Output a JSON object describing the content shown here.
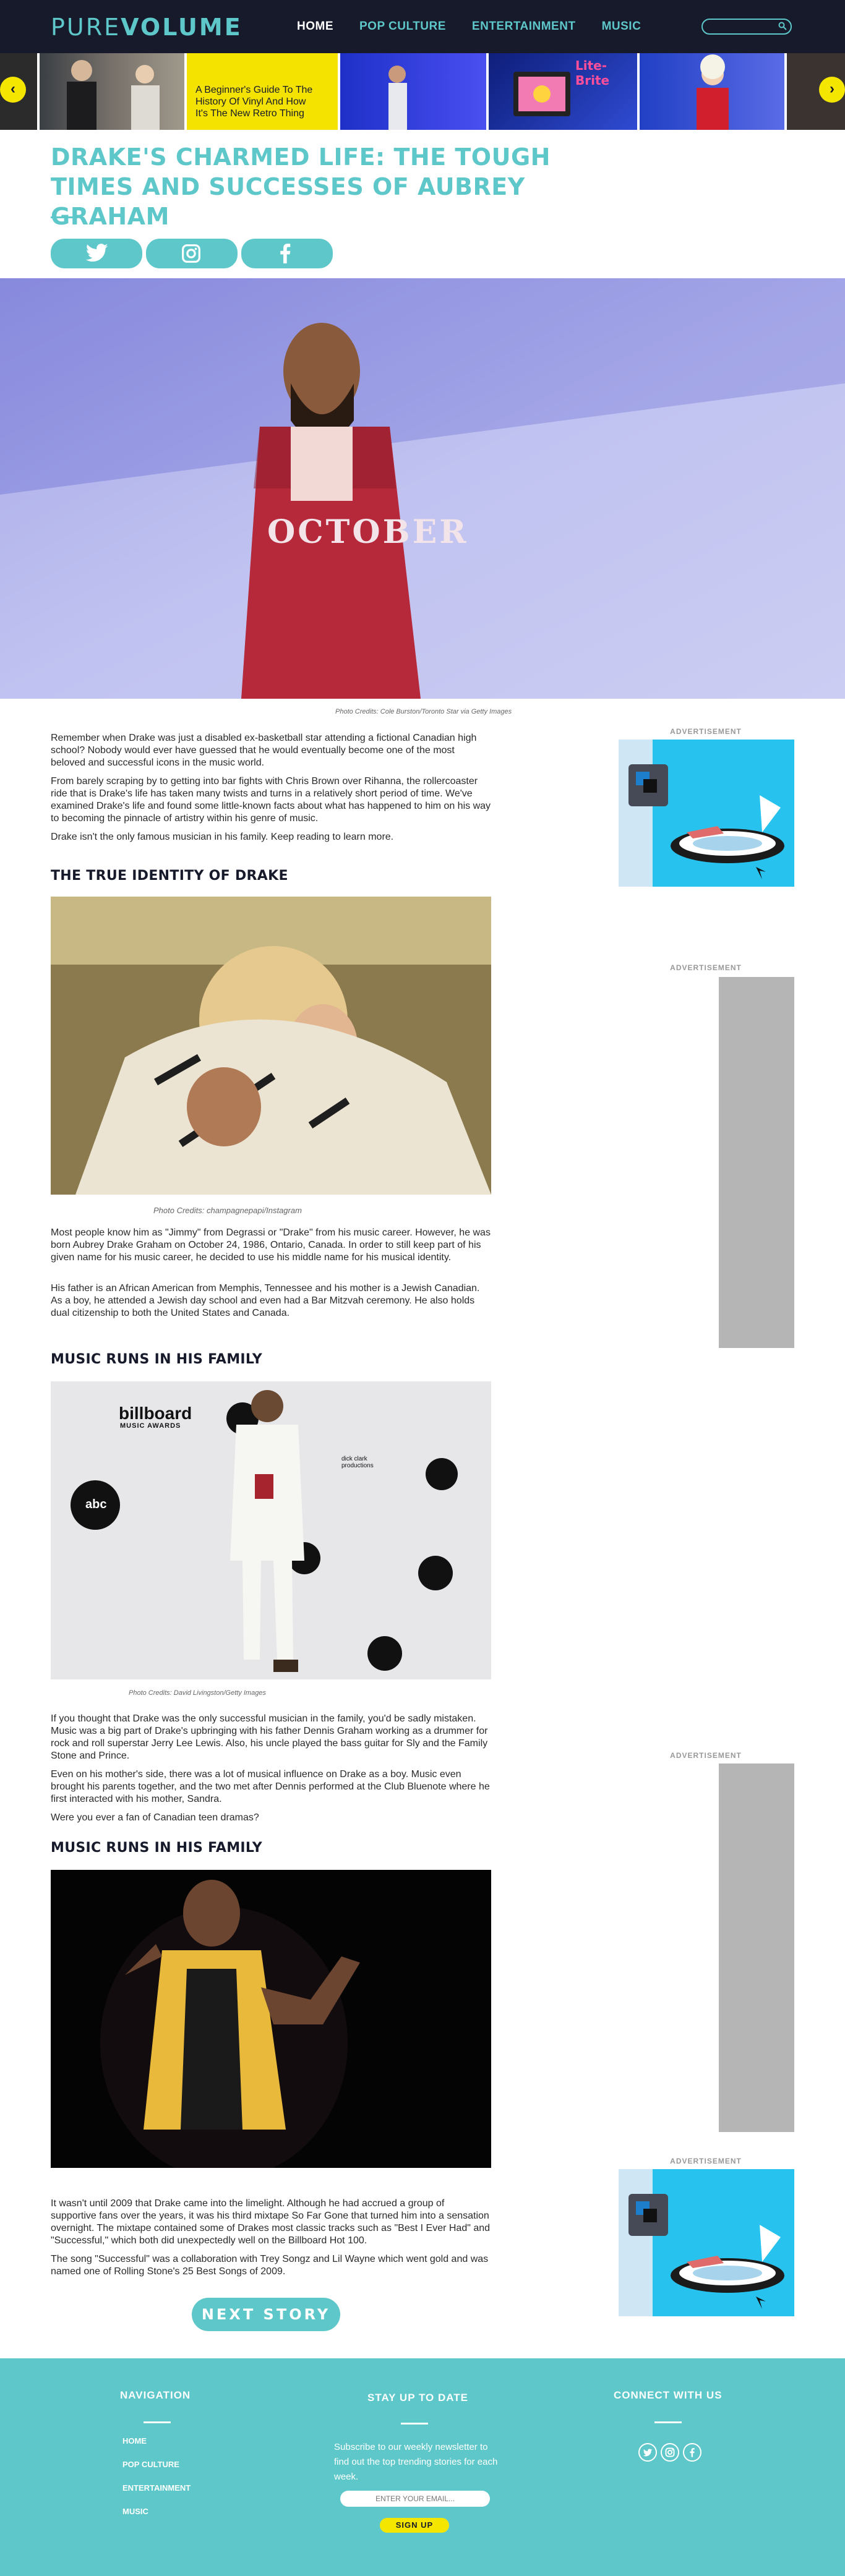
{
  "header": {
    "logo_light": "PURE",
    "logo_bold": "VOLUME",
    "nav": [
      "HOME",
      "POP CULTURE",
      "ENTERTAINMENT",
      "MUSIC"
    ],
    "search_icon": "search-icon"
  },
  "carousel": {
    "caption": "A Beginner's Guide To The History Of Vinyl And How It's The New Retro Thing",
    "badge": "Lite-Brite",
    "prev_icon": "chevron-left-icon",
    "next_icon": "chevron-right-icon"
  },
  "article": {
    "title": "DRAKE'S CHARMED LIFE: THE TOUGH TIMES AND SUCCESSES OF AUBREY GRAHAM",
    "hero_shirt": "OCTOBER",
    "hero_credit": "Photo Credits: Cole Burston/Toronto Star via Getty Images",
    "intro": [
      "Remember when Drake was just a disabled ex-basketball star attending a fictional Canadian high school? Nobody would ever have guessed that he would eventually become one of the most beloved and successful icons in the music world.",
      "From barely scraping by to getting into bar fights with Chris Brown over Rihanna, the rollercoaster ride that is Drake's life has taken many twists and turns in a relatively short period of time. We've examined Drake's life and found some little-known facts about what has happened to him on his way to becoming the pinnacle of artistry within his genre of music.",
      "Drake isn't the only famous musician in his family. Keep reading to learn more."
    ],
    "section1": {
      "heading": "THE TRUE IDENTITY OF DRAKE",
      "credit": "Photo Credits: champagnepapi/Instagram",
      "paragraphs": [
        "Most people know him as \"Jimmy\" from Degrassi or \"Drake\" from his music career. However, he was born Aubrey Drake Graham on October 24, 1986, Ontario, Canada. In order to still keep part of his given name for his music career, he decided to use his middle name for his musical identity.",
        "His father is an African American from Memphis, Tennessee and his mother is a Jewish Canadian. As a boy, he attended a Jewish day school and even had a Bar Mitzvah ceremony. He also holds dual citizenship to both the United States and Canada."
      ]
    },
    "section2": {
      "heading": "MUSIC RUNS IN HIS FAMILY",
      "credit": "Photo Credits: David Livingston/Getty Images",
      "backdrop": [
        "billboard",
        "MUSIC AWARDS",
        "abc",
        "dick clark productions"
      ],
      "paragraphs": [
        "If you thought that Drake was the only successful musician in the family, you'd be sadly mistaken. Music was a big part of Drake's upbringing with his father Dennis Graham working as a drummer for rock and roll superstar Jerry Lee Lewis. Also, his uncle played the bass guitar for Sly and the Family Stone and Prince.",
        "Even on his mother's side, there was a lot of musical influence on Drake as a boy. Music even brought his parents together, and the two met after Dennis performed at the Club Bluenote where he first interacted with his mother, Sandra.",
        "Were you ever a fan of Canadian teen dramas?"
      ]
    },
    "section3": {
      "heading": "MUSIC RUNS IN HIS FAMILY",
      "paragraphs": [
        "It wasn't until 2009 that Drake came into the limelight. Although he had accrued a group of supportive fans over the years, it was his third mixtape So Far Gone that turned him into a sensation overnight. The mixtape contained some of Drakes most classic tracks such as \"Best I Ever Had\" and \"Successful,\" which both did unexpectedly well on the Billboard Hot 100.",
        "The song \"Successful\" was a collaboration with Trey Songz and Lil Wayne which went gold and was named one of Rolling Stone's 25 Best Songs of 2009."
      ]
    },
    "next_label": "NEXT STORY"
  },
  "sidebar": {
    "ad_label": "ADVERTISEMENT"
  },
  "footer": {
    "nav_heading": "NAVIGATION",
    "nav_links": [
      "HOME",
      "POP CULTURE",
      "ENTERTAINMENT",
      "MUSIC"
    ],
    "newsletter_heading": "STAY UP TO DATE",
    "newsletter_text": "Subscribe to our weekly newsletter to find out the top trending stories for each week.",
    "email_placeholder": "ENTER YOUR EMAIL...",
    "signup_label": "SIGN UP",
    "connect_heading": "CONNECT WITH US",
    "social_icons": [
      "twitter-icon",
      "instagram-icon",
      "facebook-icon"
    ]
  },
  "colors": {
    "accent": "#5ec7c9",
    "dark": "#171a2b",
    "yellow": "#f5e600"
  }
}
